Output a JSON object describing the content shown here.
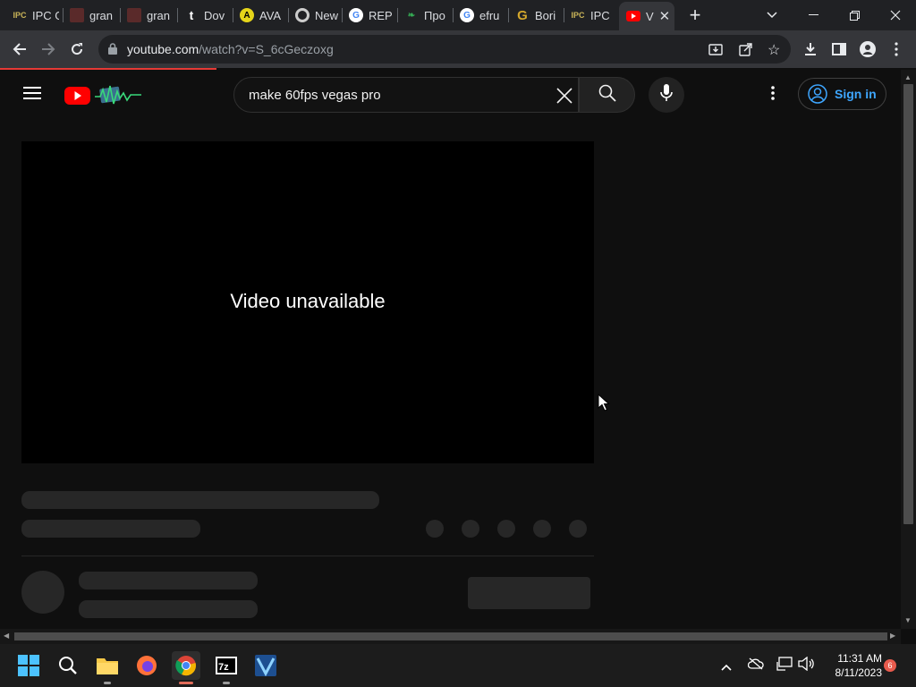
{
  "browser": {
    "tabs": [
      {
        "label": "IPC G",
        "icon": "ipc-games-icon"
      },
      {
        "label": "gran",
        "icon": "gallery-icon"
      },
      {
        "label": "gran",
        "icon": "gallery-icon"
      },
      {
        "label": "Dov",
        "icon": "tumblr-icon"
      },
      {
        "label": "AVA",
        "icon": "ava-icon"
      },
      {
        "label": "New",
        "icon": "chrome-icon"
      },
      {
        "label": "REP",
        "icon": "google-icon"
      },
      {
        "label": "Про",
        "icon": "leaf-icon"
      },
      {
        "label": "efru",
        "icon": "google-icon"
      },
      {
        "label": "Bori",
        "icon": "g-icon"
      },
      {
        "label": "IPC",
        "icon": "ipc-games-icon"
      },
      {
        "label": "V",
        "icon": "youtube-icon"
      }
    ],
    "url_host": "youtube.com",
    "url_path": "/watch?v=S_6cGeczoxg"
  },
  "youtube": {
    "search_query": "make 60fps vegas pro",
    "sign_in_label": "Sign in",
    "player_message": "Video unavailable"
  },
  "taskbar": {
    "time": "11:31 AM",
    "date": "8/11/2023",
    "notification_count": "6"
  },
  "colors": {
    "youtube_red": "#ff0000",
    "link_blue": "#3ea6ff",
    "chrome_bg": "#202124",
    "page_bg": "#0f0f0f"
  }
}
